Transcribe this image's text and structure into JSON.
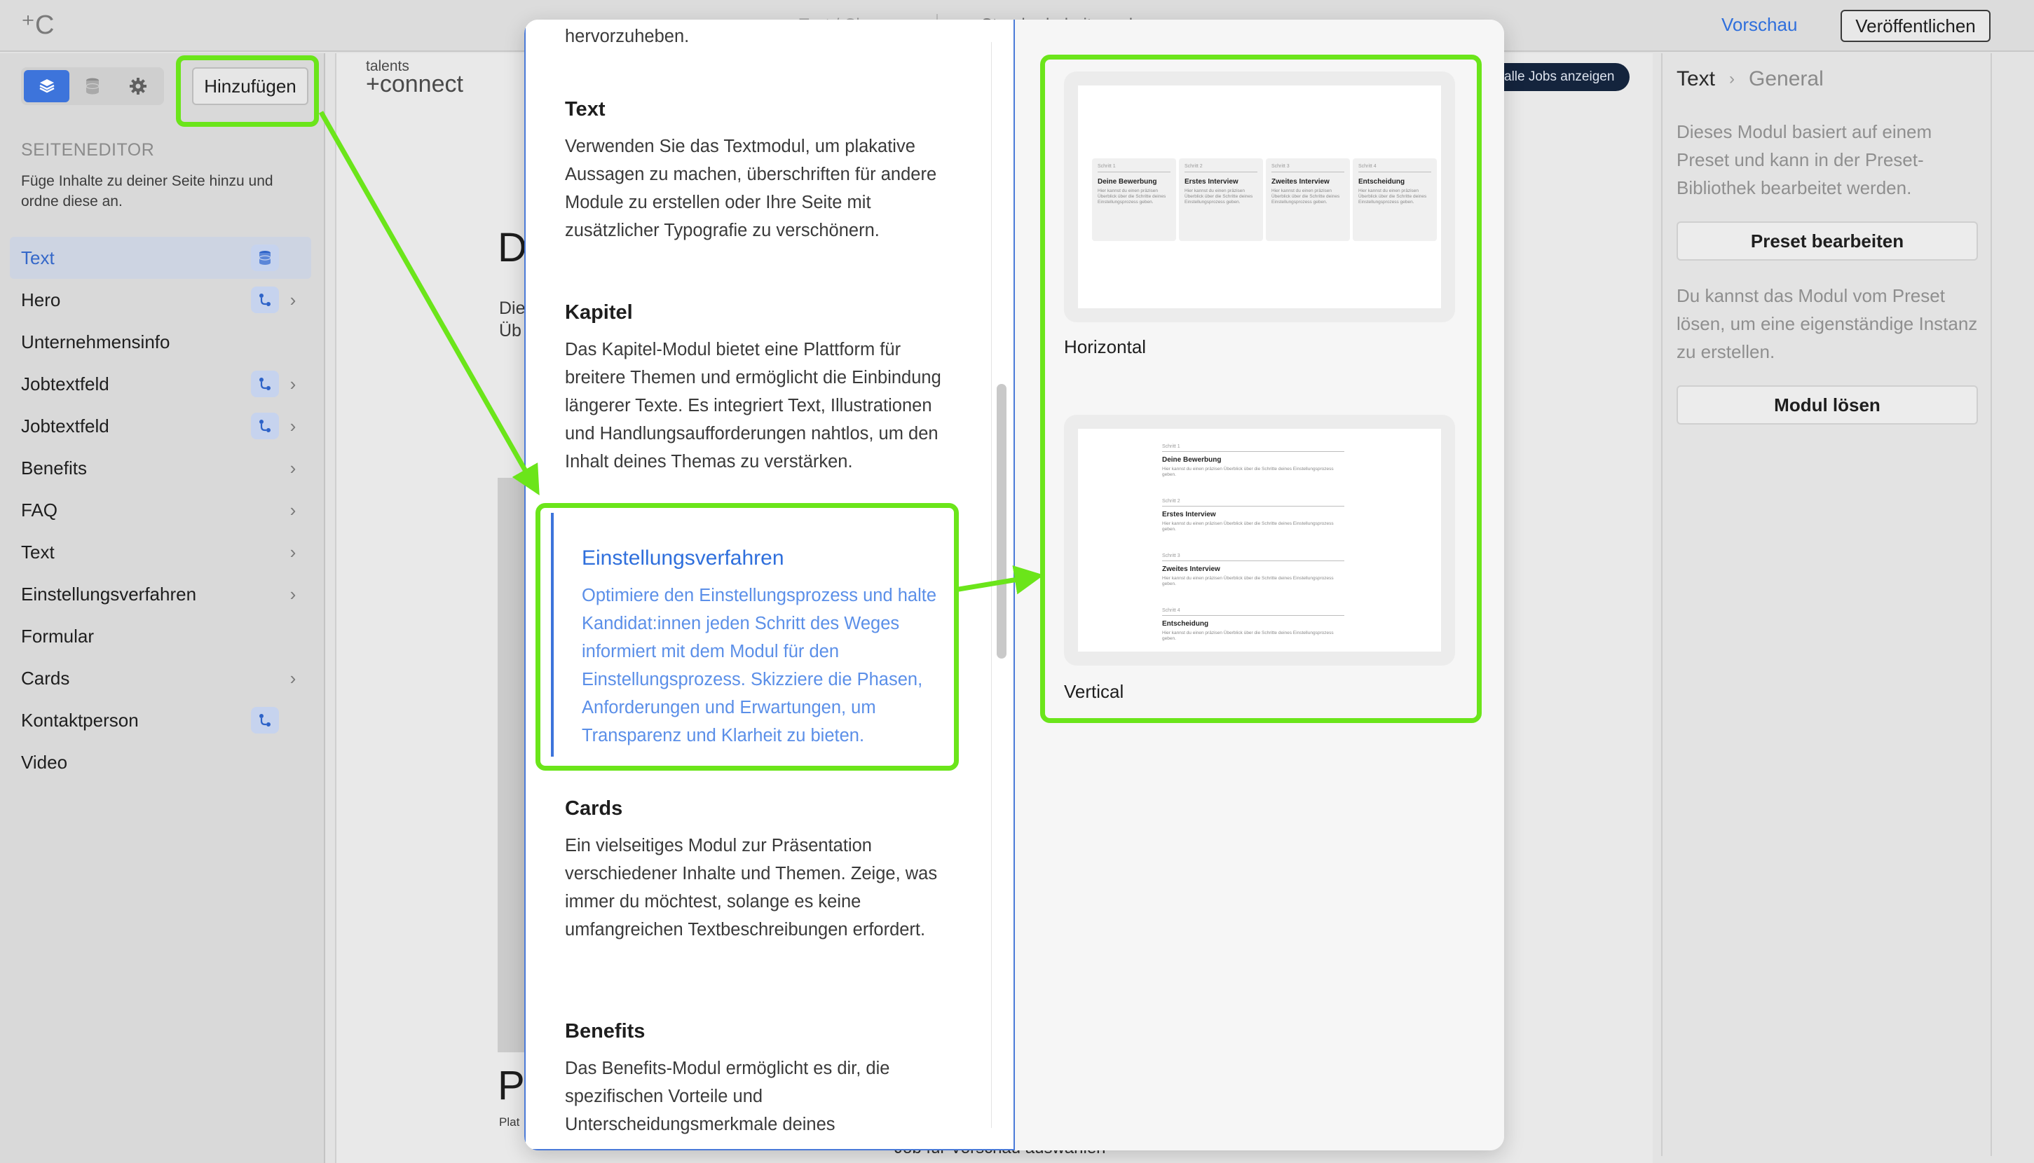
{
  "topbar": {
    "center_left": "Text / Cl",
    "center_right": "Standardarbeitsmod",
    "preview_label": "Vorschau",
    "publish_label": "Veröffentlichen"
  },
  "sidebar": {
    "tab_icons": [
      "layers-icon",
      "database-icon",
      "gear-icon"
    ],
    "add_label": "Hinzufügen",
    "editor_title": "SEITENEDITOR",
    "editor_desc": "Füge Inhalte zu deiner Seite hinzu und ordne diese an.",
    "items": [
      {
        "label": "Text",
        "badge": "database-icon",
        "chevron": false,
        "active": true
      },
      {
        "label": "Hero",
        "badge": "link-icon",
        "chevron": true
      },
      {
        "label": "Unternehmensinfo",
        "badge": null,
        "chevron": false
      },
      {
        "label": "Jobtextfeld",
        "badge": "link-icon",
        "chevron": true
      },
      {
        "label": "Jobtextfeld",
        "badge": "link-icon",
        "chevron": true
      },
      {
        "label": "Benefits",
        "badge": null,
        "chevron": true
      },
      {
        "label": "FAQ",
        "badge": null,
        "chevron": true
      },
      {
        "label": "Text",
        "badge": null,
        "chevron": true
      },
      {
        "label": "Einstellungsverfahren",
        "badge": null,
        "chevron": true
      },
      {
        "label": "Formular",
        "badge": null,
        "chevron": false
      },
      {
        "label": "Cards",
        "badge": null,
        "chevron": true
      },
      {
        "label": "Kontaktperson",
        "badge": "link-icon",
        "chevron": false
      },
      {
        "label": "Video",
        "badge": null,
        "chevron": false
      }
    ]
  },
  "canvas": {
    "brand_small": "talents",
    "brand_big": "+connect",
    "jobs_pill": "alle Jobs anzeigen",
    "heading_letter": "D",
    "text_line1": "Die",
    "text_line2": "Üb",
    "bottom_letter": "P",
    "bottom_small": "Plat",
    "bottom_button": "Job für Vorschau auswählen"
  },
  "modal": {
    "top_fragment": "hervorzuheben.",
    "modules": [
      {
        "title": "Text",
        "desc": "Verwenden Sie das Textmodul, um plakative Aussagen zu machen, überschriften für andere Module zu erstellen oder Ihre Seite mit zusätzlicher Typografie zu verschönern."
      },
      {
        "title": "Kapitel",
        "desc": "Das Kapitel-Modul bietet eine Plattform für breitere Themen und ermöglicht die Einbindung längerer Texte. Es integriert Text, Illustrationen und Handlungsaufforderungen nahtlos, um den Inhalt deines Themas zu verstärken."
      },
      {
        "title": "Einstellungsverfahren",
        "desc": "Optimiere den Einstellungsprozess und halte Kandidat:innen jeden Schritt des Weges informiert mit dem Modul für den Einstellungsprozess. Skizziere die Phasen, Anforderungen und Erwartungen, um Transparenz und Klarheit zu bieten.",
        "selected": true
      },
      {
        "title": "Cards",
        "desc": "Ein vielseitiges Modul zur Präsentation verschiedener Inhalte und Themen. Zeige, was immer du möchtest, solange es keine umfangreichen Textbeschreibungen erfordert."
      },
      {
        "title": "Benefits",
        "desc": "Das Benefits-Modul ermöglicht es dir, die spezifischen Vorteile und Unterscheidungsmerkmale deines"
      }
    ],
    "variants": [
      {
        "label": "Horizontal",
        "steps": [
          {
            "step": "Schritt 1",
            "title": "Deine Bewerbung",
            "desc": "Hier kannst du einen präzisen Überblick über die Schritte deines Einstellungsprozess geben."
          },
          {
            "step": "Schritt 2",
            "title": "Erstes Interview",
            "desc": "Hier kannst du einen präzisen Überblick über die Schritte deines Einstellungsprozess geben."
          },
          {
            "step": "Schritt 3",
            "title": "Zweites Interview",
            "desc": "Hier kannst du einen präzisen Überblick über die Schritte deines Einstellungsprozess geben."
          },
          {
            "step": "Schritt 4",
            "title": "Entscheidung",
            "desc": "Hier kannst du einen präzisen Überblick über die Schritte deines Einstellungsprozess geben."
          }
        ]
      },
      {
        "label": "Vertical",
        "steps": [
          {
            "step": "Schritt 1",
            "title": "Deine Bewerbung",
            "desc": "Hier kannst du einen präzisen Überblick über die Schritte deines Einstellungsprozess geben."
          },
          {
            "step": "Schritt 2",
            "title": "Erstes Interview",
            "desc": "Hier kannst du einen präzisen Überblick über die Schritte deines Einstellungsprozess geben."
          },
          {
            "step": "Schritt 3",
            "title": "Zweites Interview",
            "desc": "Hier kannst du einen präzisen Überblick über die Schritte deines Einstellungsprozess geben."
          },
          {
            "step": "Schritt 4",
            "title": "Entscheidung",
            "desc": "Hier kannst du einen präzisen Überblick über die Schritte deines Einstellungsprozess geben."
          }
        ]
      }
    ]
  },
  "right_panel": {
    "crumb_1": "Text",
    "crumb_2": "General",
    "info_1": "Dieses Modul basiert auf einem Preset und kann in der Preset-Bibliothek bearbeitet werden.",
    "edit_preset": "Preset bearbeiten",
    "info_2": "Du kannst das Modul vom Preset lösen, um eine eigenständige Instanz zu erstellen.",
    "detach": "Modul lösen"
  },
  "colors": {
    "accent": "#3d74db",
    "annotation": "#6be51a",
    "selected_text": "#2f6fdc"
  }
}
